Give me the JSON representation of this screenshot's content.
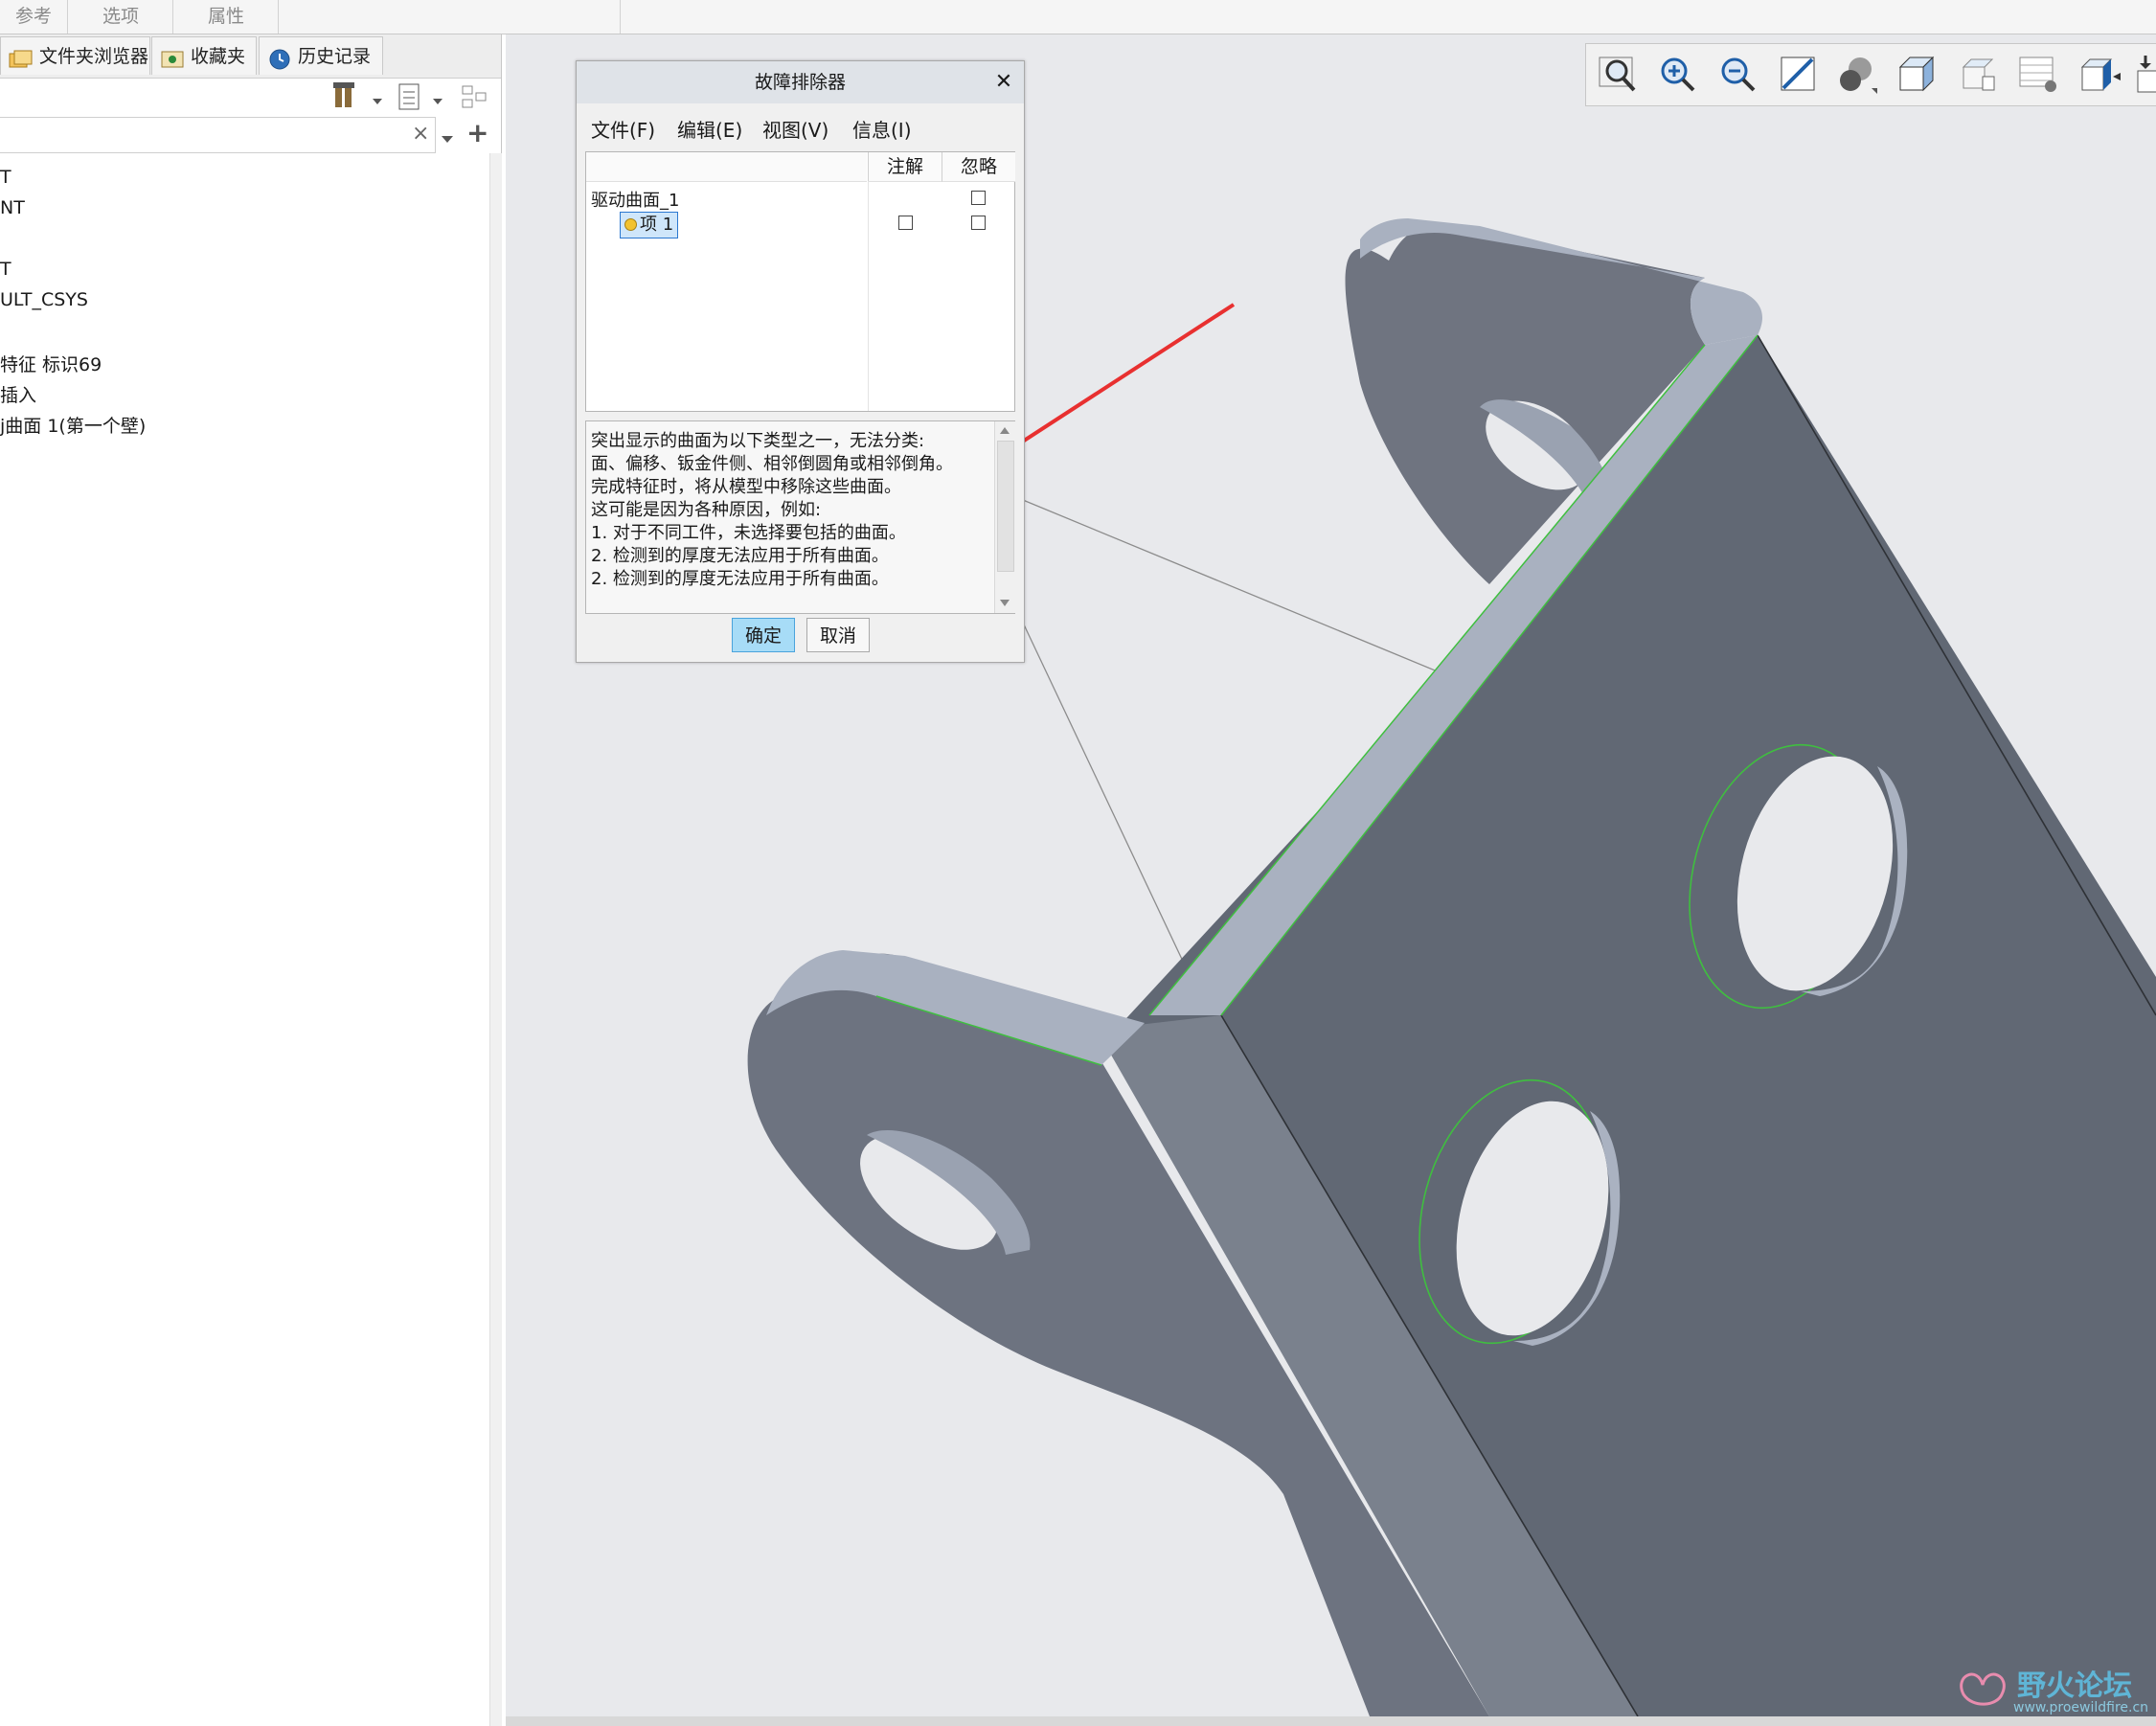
{
  "top_tabs": [
    "参考",
    "选项",
    "属性"
  ],
  "nav_tabs": [
    {
      "label": "文件夹浏览器",
      "icon": "folder-browser-icon"
    },
    {
      "label": "收藏夹",
      "icon": "favorites-icon"
    },
    {
      "label": "历史记录",
      "icon": "history-icon"
    }
  ],
  "search": {
    "value": "",
    "placeholder": ""
  },
  "tree_items": [
    "T",
    "NT",
    "T",
    "ULT_CSYS",
    "特征 标识69",
    "插入",
    "j曲面 1(第一个壁)"
  ],
  "view_toolbar": {
    "icons": [
      "zoom-fit-icon",
      "zoom-in-icon",
      "zoom-out-icon",
      "repaint-icon",
      "display-style-icon",
      "saved-views-icon",
      "view-manager-icon",
      "annotation-display-icon",
      "datum-display-icon",
      "more-icon"
    ]
  },
  "dialog": {
    "title": "故障排除器",
    "menu": [
      "文件(F)",
      "编辑(E)",
      "视图(V)",
      "信息(I)"
    ],
    "columns": [
      "注解",
      "忽略"
    ],
    "rows": [
      {
        "label": "驱动曲面_1",
        "annotate": false,
        "ignore": false
      },
      {
        "label": "项 1",
        "annotate": false,
        "ignore": false,
        "selected": true
      }
    ],
    "message_lines": [
      "突出显示的曲面为以下类型之一，无法分类:",
      "面、偏移、钣金件侧、相邻倒圆角或相邻倒角。",
      "完成特征时，将从模型中移除这些曲面。",
      "这可能是因为各种原因，例如:",
      "1. 对于不同工件，未选择要包括的曲面。",
      "2. 检测到的厚度无法应用于所有曲面。",
      "2. 检测到的厚度无法应用于所有曲面。"
    ],
    "ok_label": "确定",
    "cancel_label": "取消"
  },
  "watermark": {
    "text": "野火论坛",
    "url": "www.proewildfire.cn"
  },
  "colors": {
    "model_face": "#6a707c",
    "model_edge_face": "#a8b0bf",
    "selection_edge": "#3fbf3f",
    "arrow": "#e83030",
    "ok_button": "#a7dcf7"
  }
}
